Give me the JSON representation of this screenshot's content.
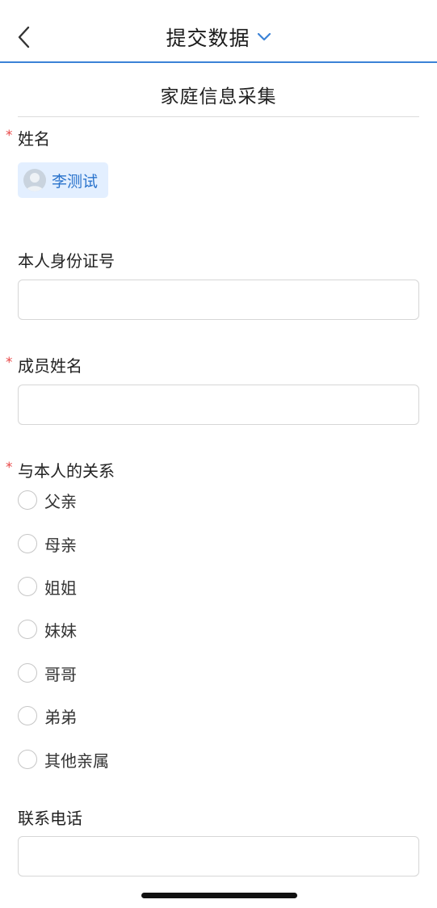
{
  "nav": {
    "title": "提交数据",
    "back_icon": "chevron-left-icon",
    "dropdown_icon": "chevron-down-icon",
    "accent_color": "#3b82d6"
  },
  "form": {
    "title": "家庭信息采集",
    "name_field": {
      "label": "姓名",
      "required": "*",
      "value": "李测试"
    },
    "id_field": {
      "label": "本人身份证号",
      "value": ""
    },
    "member_name_field": {
      "label": "成员姓名",
      "required": "*",
      "value": ""
    },
    "relation_field": {
      "label": "与本人的关系",
      "required": "*",
      "options": [
        "父亲",
        "母亲",
        "姐姐",
        "妹妹",
        "哥哥",
        "弟弟",
        "其他亲属"
      ],
      "selected": ""
    },
    "phone_field": {
      "label": "联系电话",
      "value": ""
    }
  }
}
